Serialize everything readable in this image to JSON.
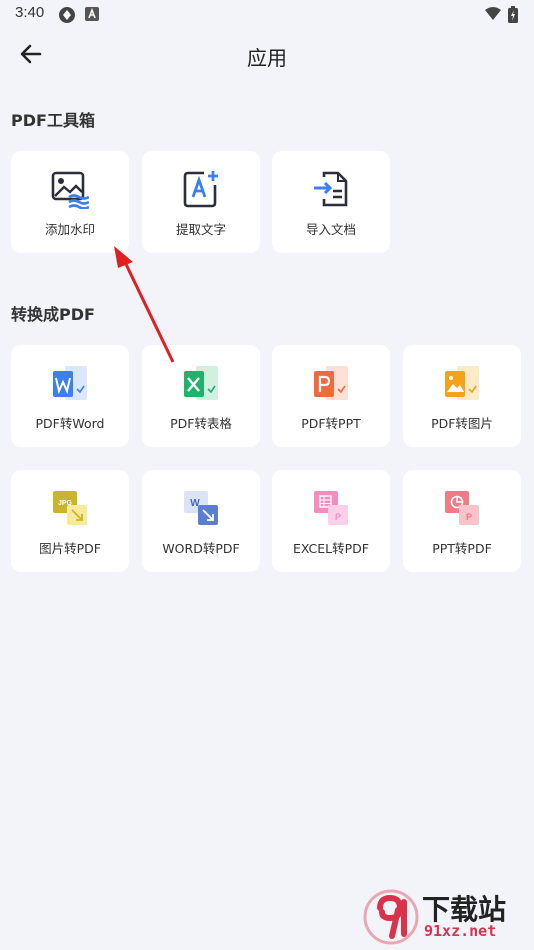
{
  "status_bar": {
    "time": "3:40"
  },
  "app_bar": {
    "title": "应用"
  },
  "sections": [
    {
      "title": "PDF工具箱",
      "items": [
        {
          "label": "添加水印",
          "icon": "watermark-icon"
        },
        {
          "label": "提取文字",
          "icon": "extract-text-icon"
        },
        {
          "label": "导入文档",
          "icon": "import-doc-icon"
        }
      ]
    },
    {
      "title": "转换成PDF",
      "items": [
        {
          "label": "PDF转Word",
          "icon": "pdf-to-word-icon"
        },
        {
          "label": "PDF转表格",
          "icon": "pdf-to-excel-icon"
        },
        {
          "label": "PDF转PPT",
          "icon": "pdf-to-ppt-icon"
        },
        {
          "label": "PDF转图片",
          "icon": "pdf-to-image-icon"
        },
        {
          "label": "图片转PDF",
          "icon": "image-to-pdf-icon"
        },
        {
          "label": "WORD转PDF",
          "icon": "word-to-pdf-icon"
        },
        {
          "label": "EXCEL转PDF",
          "icon": "excel-to-pdf-icon"
        },
        {
          "label": "PPT转PDF",
          "icon": "ppt-to-pdf-icon"
        }
      ]
    }
  ],
  "watermark": {
    "brand": "下载站",
    "domain": "91xz.net"
  },
  "colors": {
    "background": "#f2f4f9",
    "card": "#ffffff",
    "word_blue": "#3b7ff0",
    "excel_green": "#20b26a",
    "ppt_orange": "#ef6a3c",
    "image_orange": "#f4a21c",
    "arrow_red": "#e02020"
  }
}
